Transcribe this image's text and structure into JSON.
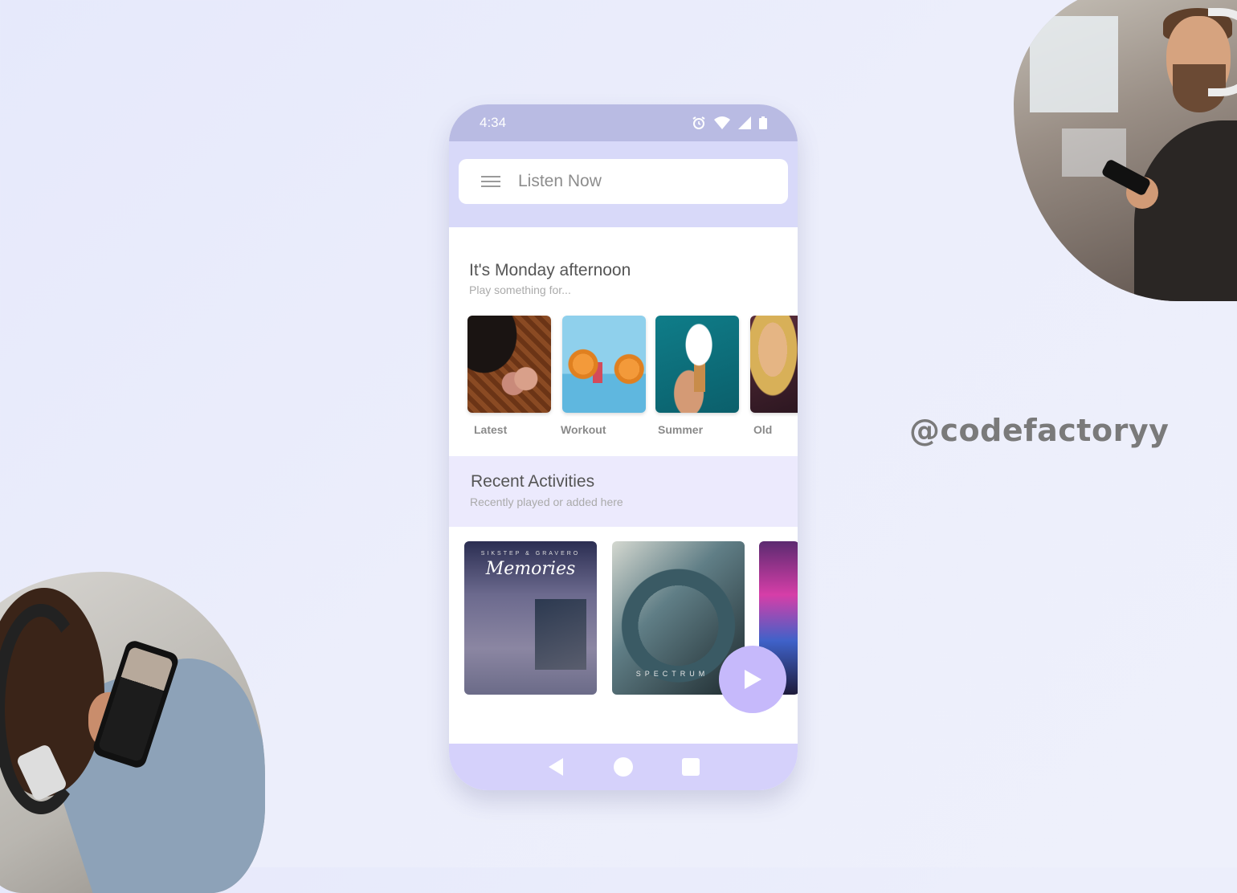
{
  "status_bar": {
    "time": "4:34"
  },
  "search": {
    "label": "Listen Now"
  },
  "section_playlists": {
    "title": "It's Monday afternoon",
    "subtitle": "Play something for...",
    "cards": [
      {
        "label": "Latest"
      },
      {
        "label": "Workout"
      },
      {
        "label": "Summer"
      },
      {
        "label": "Old"
      }
    ]
  },
  "section_recent": {
    "title": "Recent Activities",
    "subtitle": "Recently played or added here",
    "albums": [
      {
        "small": "SIKSTEP & GRAVERO",
        "big": "Memories"
      },
      {
        "text": "SPECTRUM"
      },
      {}
    ]
  },
  "watermark": "@codefactoryy",
  "colors": {
    "status_bar": "#b9bbe3",
    "top_bar": "#d8d9f9",
    "recent_bg": "#eceafd",
    "fab": "#c6b9fb",
    "nav_bar": "#d5d1fb"
  },
  "icons": [
    "alarm-icon",
    "wifi-icon",
    "signal-icon",
    "battery-icon",
    "menu-icon",
    "play-icon",
    "back-icon",
    "home-icon",
    "recents-icon"
  ]
}
